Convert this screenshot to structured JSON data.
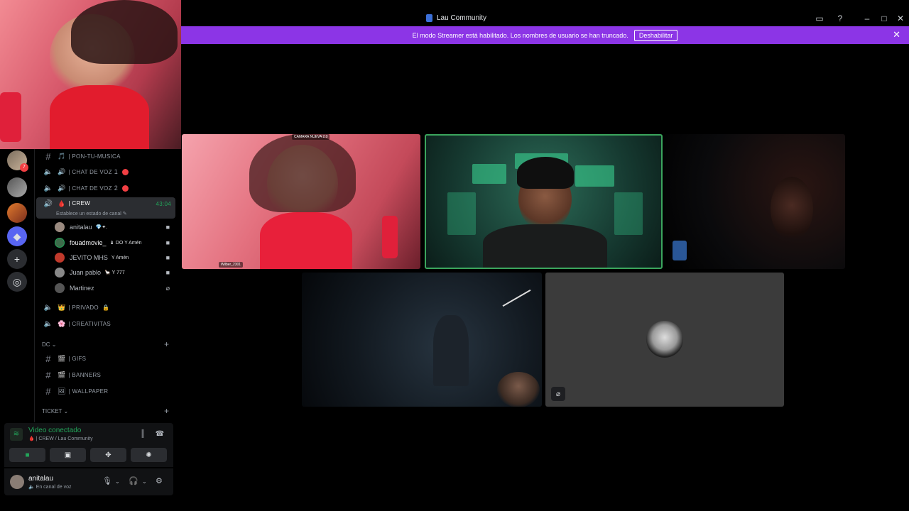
{
  "window": {
    "title": "Lau Community"
  },
  "banner": {
    "message": "El modo Streamer está habilitado. Los nombres de usuario se han truncado.",
    "button_label": "Deshabilitar"
  },
  "rail": {
    "badge_count": "7"
  },
  "channels": [
    {
      "type": "text",
      "emoji": "🎵",
      "label": "| PON-TU-MUSICA"
    },
    {
      "type": "voice",
      "label": "| CHAT DE VOZ",
      "number": "1",
      "status_color": "#f23f43"
    },
    {
      "type": "voice",
      "label": "| CHAT DE VOZ",
      "number": "2",
      "status_color": "#f23f43"
    }
  ],
  "active_channel": {
    "emoji": "🩸",
    "label": "| CREW",
    "timer": "43:04",
    "status_placeholder": "Establece un estado de canal"
  },
  "voice_users": [
    {
      "name": "anitalau",
      "badge": "💎✦.",
      "video": true
    },
    {
      "name": "fouadmovie_",
      "badge": "♝ DO  Y Amén",
      "video": true
    },
    {
      "name": "JEVITO MHS",
      "badge": "Y Amén",
      "video": true
    },
    {
      "name": "Juan pablo",
      "badge": "🦙  Y 777",
      "video": true
    },
    {
      "name": "Martinez",
      "badge": "",
      "video": false
    }
  ],
  "more_channels": [
    {
      "type": "voice",
      "emoji": "👑",
      "label": "| PRIVADO",
      "suffix": "🔒"
    },
    {
      "type": "voice",
      "emoji": "🌸",
      "label": "| CREATIVITAS"
    }
  ],
  "category_dc": {
    "label": "DC",
    "channels": [
      {
        "emoji": "🎬",
        "label": "| GIFS"
      },
      {
        "emoji": "🎬",
        "label": "| BANNERS"
      },
      {
        "emoji": "🖼",
        "label": "| WALLPAPER"
      }
    ]
  },
  "category_ticket": {
    "label": "TICKET"
  },
  "voice_panel": {
    "status": "Video conectado",
    "channel": "| CREW / Lau Community"
  },
  "user_panel": {
    "name": "anitalau",
    "status": "En canal de voz"
  },
  "tiles": {
    "tile1_label": "CAMARA NUEVA 2.0",
    "tile1_sublabel": "Wilber_2301"
  }
}
